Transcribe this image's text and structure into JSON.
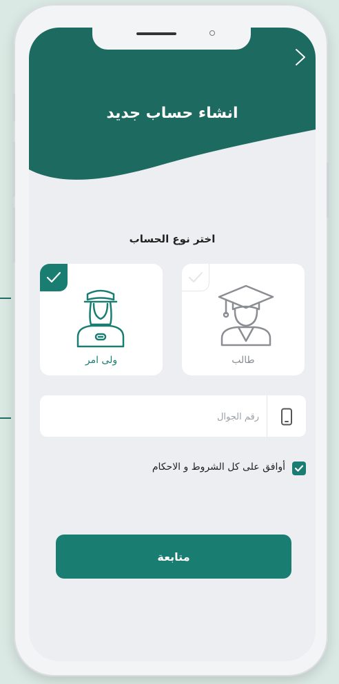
{
  "colors": {
    "primary": "#1a7d72",
    "header": "#1d6b60",
    "phone_frame": "#f3f4f5",
    "screen_bg": "#edeef1"
  },
  "header": {
    "title": "انشاء حساب جديد",
    "back_icon": "chevron-right-icon"
  },
  "account_type": {
    "label": "اختر نوع الحساب",
    "options": [
      {
        "label": "ولى امر",
        "icon": "guardian-icon",
        "selected": true
      },
      {
        "label": "طالب",
        "icon": "graduate-student-icon",
        "selected": false
      }
    ]
  },
  "phone_field": {
    "placeholder": "رقم الجوال",
    "value": "",
    "icon": "mobile-phone-icon"
  },
  "terms": {
    "label": "أوافق على كل الشروط و الاحكام",
    "checked": true
  },
  "continue_label": "متابعة"
}
